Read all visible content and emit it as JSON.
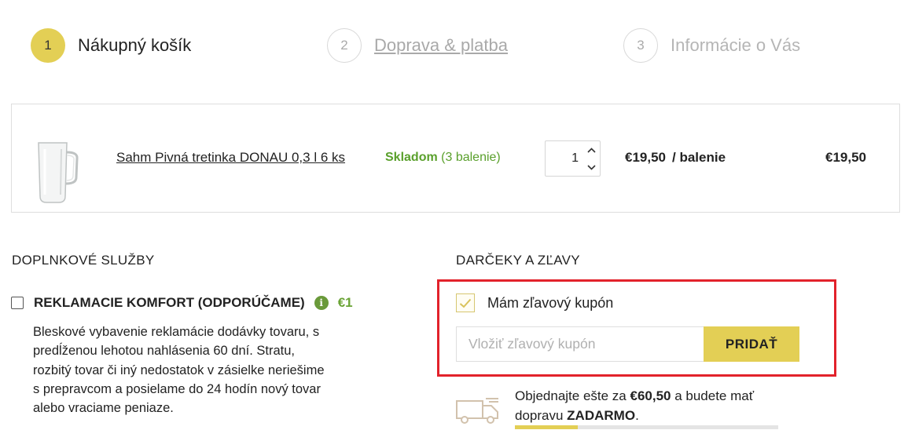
{
  "steps": [
    {
      "number": "1",
      "label": "Nákupný košík"
    },
    {
      "number": "2",
      "label": "Doprava & platba"
    },
    {
      "number": "3",
      "label": "Informácie o Vás"
    }
  ],
  "cart": {
    "item": {
      "name": "Sahm Pivná tretinka DONAU 0,3 l 6 ks",
      "stock_status": "Skladom",
      "stock_detail": "(3 balenie)",
      "quantity": "1",
      "unit_price": "€19,50",
      "unit_label": "/ balenie",
      "total_price": "€19,50"
    }
  },
  "services": {
    "title": "DOPLNKOVÉ SLUŽBY",
    "item": {
      "name": "REKLAMACIE KOMFORT (ODPORÚČAME)",
      "info_icon": "i",
      "price": "€1",
      "checked": false,
      "description": "Bleskové vybavenie reklamácie dodávky tovaru, s predĺženou lehotou nahlásenia 60 dní. Stratu, rozbitý tovar či iný nedostatok v zásielke neriešime s prepravcom a posielame do 24 hodín nový tovar alebo vraciame peniaze."
    }
  },
  "discounts": {
    "title": "DARČEKY A ZĽAVY",
    "coupon_checkbox_label": "Mám zľavový kupón",
    "coupon_checked": true,
    "coupon_placeholder": "Vložiť zľavový kupón",
    "add_button": "PRIDAŤ"
  },
  "shipping": {
    "text_before": "Objednajte ešte za ",
    "amount": "€60,50",
    "text_middle": " a budete mať dopravu ",
    "free_label": "ZADARMO",
    "text_after": ".",
    "progress": 0.24
  },
  "colors": {
    "accent": "#e3cf55",
    "stock_green": "#5aa02c",
    "highlight_red": "#e2222b"
  },
  "icons": [
    "check-icon",
    "info-icon",
    "truck-icon",
    "chevron-up-icon",
    "chevron-down-icon"
  ]
}
